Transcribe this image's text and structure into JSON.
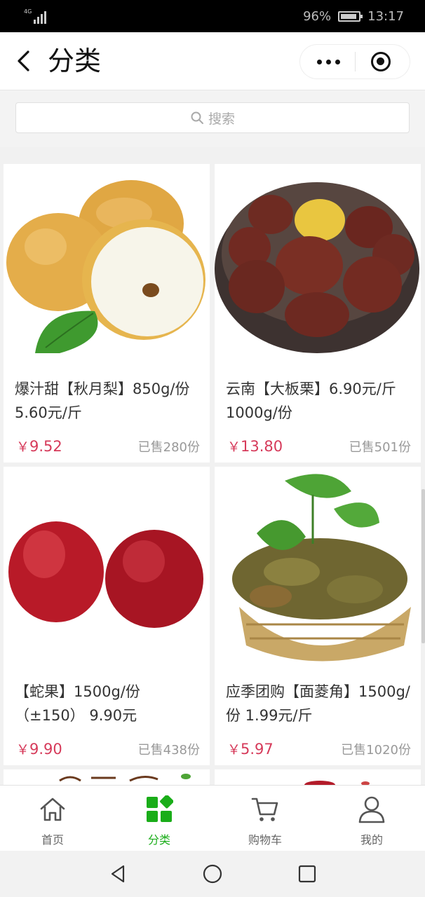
{
  "status_bar": {
    "network": "4G",
    "battery": "96%",
    "time": "13:17"
  },
  "header": {
    "title": "分类"
  },
  "search": {
    "placeholder": "搜索"
  },
  "products": [
    {
      "name": "爆汁甜【秋月梨】850g/份 5.60元/斤",
      "price": "9.52",
      "sold": "已售280份",
      "image": "pear-image"
    },
    {
      "name": "云南【大板栗】6.90元/斤1000g/份",
      "price": "13.80",
      "sold": "已售501份",
      "image": "chestnut-image"
    },
    {
      "name": "【蛇果】1500g/份（±150） 9.90元",
      "price": "9.90",
      "sold": "已售438份",
      "image": "apple-image"
    },
    {
      "name": "应季团购【面菱角】1500g/份 1.99元/斤",
      "price": "5.97",
      "sold": "已售1020份",
      "image": "water-caltrop-image"
    }
  ],
  "currency_symbol": "￥",
  "tabs": [
    {
      "label": "首页",
      "icon": "home-icon",
      "active": false
    },
    {
      "label": "分类",
      "icon": "category-icon",
      "active": true
    },
    {
      "label": "购物车",
      "icon": "cart-icon",
      "active": false
    },
    {
      "label": "我的",
      "icon": "user-icon",
      "active": false
    }
  ],
  "colors": {
    "accent": "#1aad19",
    "price": "#d63a5a"
  }
}
